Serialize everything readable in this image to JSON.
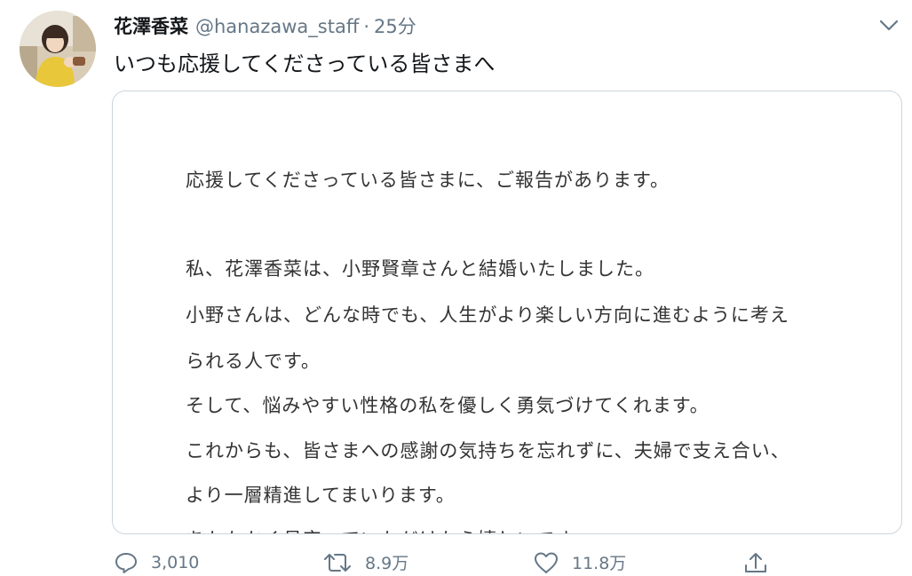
{
  "tweet": {
    "display_name": "花澤香菜",
    "handle": "@hanazawa_staff",
    "separator": "·",
    "time": "25分",
    "text": "いつも応援してくださっている皆さまへ",
    "image_lines": [
      "応援してくださっている皆さまに、ご報告があります。",
      "私、花澤香菜は、小野賢章さんと結婚いたしました。",
      "小野さんは、どんな時でも、人生がより楽しい方向に進むように考え",
      "られる人です。",
      "そして、悩みやすい性格の私を優しく勇気づけてくれます。",
      "これからも、皆さまへの感謝の気持ちを忘れずに、夫婦で支え合い、",
      "より一層精進してまいります。",
      "あたたかく見守っていただけたら嬉しいです。"
    ]
  },
  "actions": {
    "reply_count": "3,010",
    "retweet_count": "8.9万",
    "like_count": "11.8万"
  },
  "icons": {
    "avatar": "avatar-photo",
    "menu": "chevron-down-icon",
    "reply": "reply-icon",
    "retweet": "retweet-icon",
    "like": "heart-icon",
    "share": "share-icon"
  },
  "colors": {
    "text": "#14171a",
    "secondary": "#657786",
    "border": "#ccd6dd"
  }
}
